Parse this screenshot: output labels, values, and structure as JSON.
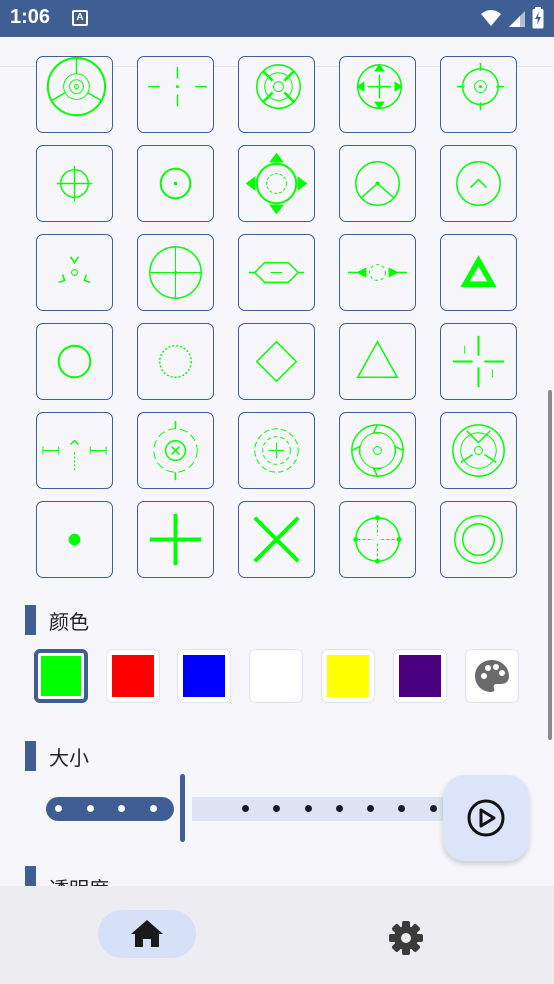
{
  "status_bar": {
    "time": "1:06",
    "notification_glyph": "A",
    "icons": [
      "wifi-icon",
      "signal-icon",
      "battery-charging-icon"
    ]
  },
  "crosshair_color": "#00ff00",
  "accent_color": "#3f5e93",
  "crosshairs": [
    "triple-ring",
    "sparse-cross",
    "x-ring",
    "arrow-ring",
    "circle-dot",
    "small-crosshair",
    "dot-circle",
    "arrow-target",
    "v-ring",
    "caret-ring",
    "tri-dots",
    "quad-circle",
    "hex-lens",
    "side-arrows",
    "filled-triangle",
    "plain-circle",
    "dotted-circle",
    "diamond",
    "triangle",
    "gap-cross",
    "rangefinder",
    "ring-x",
    "dashed-ring",
    "notched-ring",
    "segmented-ring",
    "center-dot",
    "plus",
    "cross-x",
    "dotted-crosshair",
    "double-circle"
  ],
  "color_section": {
    "title": "颜色",
    "swatches": [
      {
        "color": "#00ff00",
        "selected": true
      },
      {
        "color": "#ff0000",
        "selected": false
      },
      {
        "color": "#0000ff",
        "selected": false
      },
      {
        "color": "#ffffff",
        "selected": false
      },
      {
        "color": "#ffff00",
        "selected": false
      },
      {
        "color": "#4b0082",
        "selected": false
      }
    ],
    "palette_icon": "palette-icon"
  },
  "size_section": {
    "title": "大小",
    "slider_value": 0.32,
    "steps": 13
  },
  "opacity_section": {
    "title": "透明度"
  },
  "fab": {
    "icon": "play-circle-icon"
  },
  "bottom_nav": [
    {
      "icon": "home-icon",
      "active": true
    },
    {
      "icon": "settings-icon",
      "active": false
    }
  ]
}
